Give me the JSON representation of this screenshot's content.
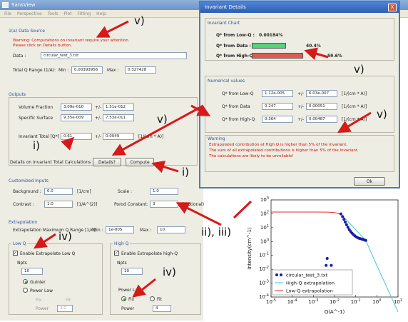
{
  "window": {
    "title": "SansView"
  },
  "menu": [
    "File",
    "Perspective",
    "Tools",
    "Plot",
    "Fitting",
    "Help"
  ],
  "data_source": {
    "section_title": "1(a) Data Source",
    "warning": [
      "Warning: Computations on invariant require your attention.",
      "Please click on Details button."
    ],
    "data_label": "Data :",
    "data_value": "circular_test_3.txt",
    "qrange_label": "Total Q Range (1/A):",
    "min_label": "Min :",
    "min_value": "0.00393956",
    "max_label": "Max :",
    "max_value": "0.327428"
  },
  "outputs": {
    "section_title": "Outputs",
    "volume_fraction_label": "Volume Fraction",
    "volume_fraction_value": "3.09e-010",
    "volume_fraction_err": "1.51e-012",
    "specific_surface_label": "Specific Surface",
    "specific_surface_value": "9.35e-009",
    "specific_surface_err": "7.53e-011",
    "pm": "+/-",
    "invariant_label": "Invariant Total [Q*]",
    "invariant_value": "0.61",
    "invariant_err": "0.0049",
    "invariant_unit": "[1/(cm * A)]",
    "details_label": "Details on Invariant Total Calculations :",
    "details_button": "Details?",
    "compute_button": "Compute"
  },
  "customized_inputs": {
    "section_title": "Customized Inputs",
    "background_label": "Background :",
    "background_value": "0.0",
    "background_unit": "[1/cm]",
    "scale_label": "Scale :",
    "scale_value": "1.0",
    "contrast_label": "Contrast :",
    "contrast_value": "1.0",
    "contrast_unit": "[1/A^(2)]",
    "porod_label": "Porod Constant:",
    "porod_value": "3",
    "porod_unit": "(Optional)"
  },
  "extrapolation": {
    "section_title": "Extrapolation",
    "qrange_label": "Extrapolation Maximum Q Range [1/A]:",
    "min_label": "Min :",
    "min_value": "1e-005",
    "max_label": "Max :",
    "max_value": "10",
    "low_q": {
      "title": "Low Q",
      "enable_label": "Enable Extrapolate Low Q",
      "npts_label": "Npts",
      "npts_value": "10",
      "guinier_label": "Guinier",
      "power_law_label": "Power Law",
      "fix_label": "Fix",
      "fit_label": "Fit",
      "power_label": "Power",
      "power_value": "4.0"
    },
    "high_q": {
      "title": "High Q",
      "enable_label": "Enable Extrapolate high-Q",
      "npts_label": "Npts",
      "npts_value": "10",
      "power_law_label": "Power Law",
      "fix_label": "Fix",
      "fit_label": "Fit",
      "power_label": "Power",
      "power_value": "4"
    }
  },
  "details_dialog": {
    "title": "Invariant Details",
    "close_glyph": "X",
    "chart_section": "Invariant Chart",
    "low_q_label": "Q* from Low-Q :",
    "low_q_percent": "0.00184%",
    "data_label": "Q* from Data :",
    "data_percent": "40.4%",
    "data_fraction": 0.404,
    "high_q_label": "Q* from High-Q :",
    "high_q_percent": "59.6%",
    "high_q_fraction": 0.596,
    "numerical_section": "Numerical values",
    "rows": [
      {
        "label": "Q* from Low-Q",
        "value": "1.12e-005",
        "err": "6.03e-007",
        "unit": "[1/(cm * A)]"
      },
      {
        "label": "Q* from Data",
        "value": "0.247",
        "err": "0.00051",
        "unit": "[1/(cm * A)]"
      },
      {
        "label": "Q* from High-Q",
        "value": "0.364",
        "err": "0.00487",
        "unit": "[1/(cm * A)]"
      }
    ],
    "pm": "+/-",
    "warning_section": "Warning",
    "warning": [
      "Extrapolated contribution at High Q is higher than 5% of the invariant.",
      "The sum of all extrapolated contributions is higher than 5% of the invariant.",
      "The calculations are likely to be unreliable!"
    ],
    "ok_button": "Ok",
    "colors": {
      "data_bar": "#55d27a",
      "high_q_bar": "#e05a50"
    }
  },
  "annotations": [
    "v)",
    "v)",
    "v)",
    "v)",
    "i)",
    "i)",
    "iv)",
    "iv)",
    "ii), iii)"
  ],
  "chart_data": {
    "type": "scatter",
    "xlabel": "Q(A^-1)",
    "ylabel": "Intensity(cm^-1)",
    "xlim": [
      1e-05,
      10
    ],
    "ylim": [
      0.0001,
      10000.0
    ],
    "x_scale": "log",
    "y_scale": "log",
    "x_ticks": [
      "10^-5",
      "10^-4",
      "10^-3",
      "10^-2",
      "10^-1",
      "10^0",
      "10^1"
    ],
    "y_ticks": [
      "10^-4",
      "10^-3",
      "10^-2",
      "10^-1",
      "10^0",
      "10^1",
      "10^2",
      "10^3"
    ],
    "legend_position": "bottom-left",
    "series": [
      {
        "name": "circular_test_3.txt",
        "style": "points",
        "color": "#1a1aa8",
        "x": [
          0.004,
          0.007,
          0.0045,
          0.02,
          0.024,
          0.028,
          0.032,
          0.037,
          0.043,
          0.05,
          0.058,
          0.067,
          0.078,
          0.09,
          0.105,
          0.12,
          0.14,
          0.16,
          0.19,
          0.22,
          0.26,
          0.3
        ],
        "y": [
          0.04,
          0.04,
          0.15,
          700,
          420,
          250,
          150,
          90,
          55,
          35,
          25,
          18,
          14,
          11,
          9,
          8,
          7,
          6.5,
          6,
          5.5,
          5,
          4.6
        ]
      },
      {
        "name": "High-Q extrapolation",
        "style": "line",
        "color": "#3fc6d8",
        "x": [
          0.02,
          0.3,
          1,
          3,
          10
        ],
        "y": [
          700,
          4.6,
          0.04,
          0.0006,
          6e-06
        ]
      },
      {
        "name": "Low-Q extrapolation",
        "style": "line",
        "color": "#e03030",
        "x": [
          1e-05,
          0.0001,
          0.001,
          0.005,
          0.01,
          0.02
        ],
        "y": [
          1000,
          1000,
          1000,
          980,
          900,
          700
        ]
      }
    ]
  }
}
